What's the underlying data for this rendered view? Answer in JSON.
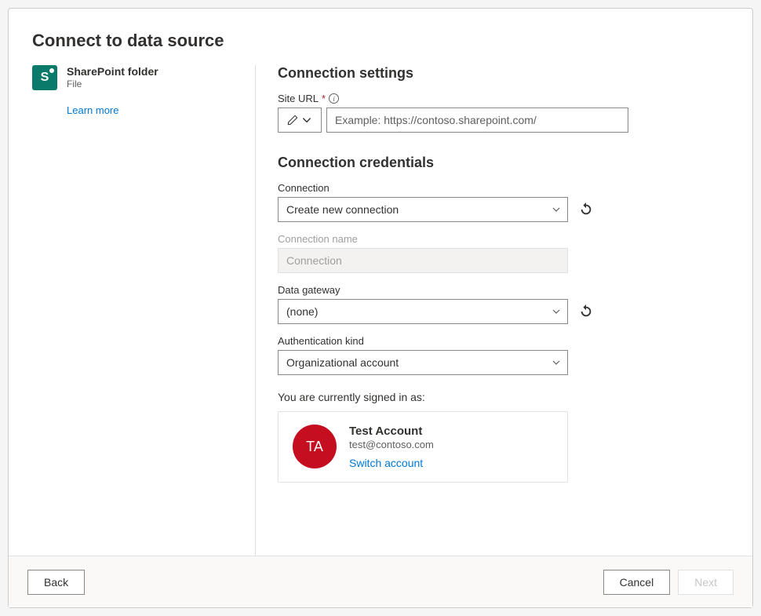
{
  "header": {
    "title": "Connect to data source"
  },
  "source": {
    "icon_letter": "S",
    "title": "SharePoint folder",
    "subtitle": "File",
    "learn_more": "Learn more"
  },
  "settings": {
    "section_title": "Connection settings",
    "site_url_label": "Site URL",
    "site_url_placeholder": "Example: https://contoso.sharepoint.com/"
  },
  "credentials": {
    "section_title": "Connection credentials",
    "connection_label": "Connection",
    "connection_value": "Create new connection",
    "connection_name_label": "Connection name",
    "connection_name_value": "Connection",
    "gateway_label": "Data gateway",
    "gateway_value": "(none)",
    "auth_label": "Authentication kind",
    "auth_value": "Organizational account",
    "signed_in_label": "You are currently signed in as:",
    "account": {
      "initials": "TA",
      "name": "Test Account",
      "email": "test@contoso.com",
      "switch": "Switch account"
    }
  },
  "footer": {
    "back": "Back",
    "cancel": "Cancel",
    "next": "Next"
  }
}
